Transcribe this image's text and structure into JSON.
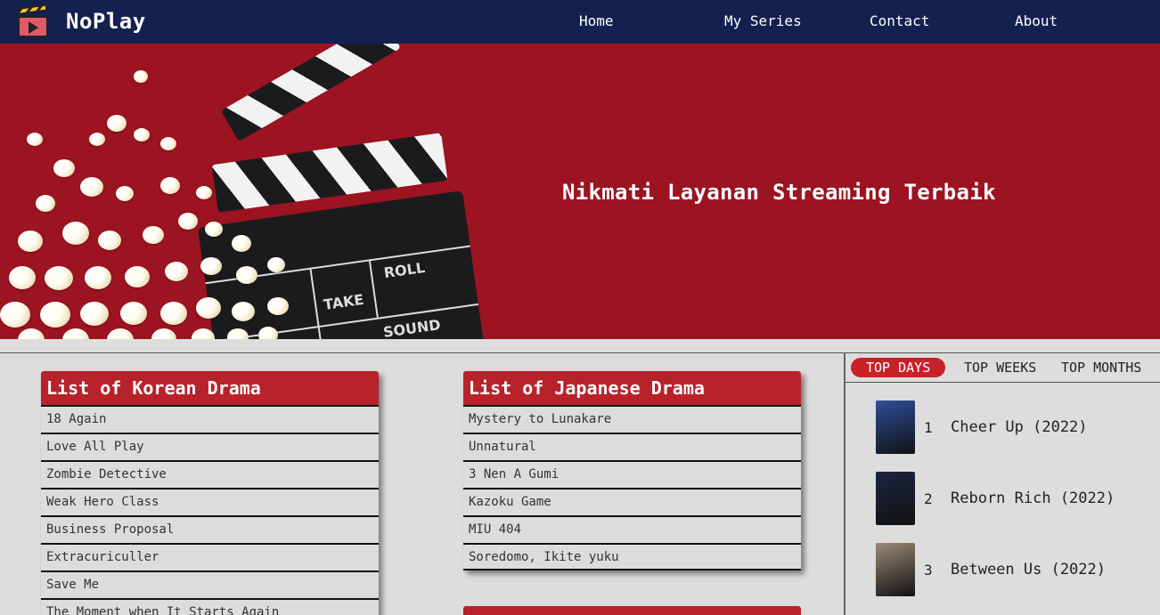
{
  "brand": {
    "name": "NoPlay"
  },
  "nav": [
    "Home",
    "My Series",
    "Contact",
    "About"
  ],
  "hero": {
    "title": "Nikmati Layanan Streaming Terbaik",
    "clapper_labels": [
      "TAKE",
      "ROLL",
      "SOUND"
    ]
  },
  "korean": {
    "title": "List of Korean Drama",
    "items": [
      "18 Again",
      "Love All Play",
      "Zombie Detective",
      "Weak Hero Class",
      "Business Proposal",
      "Extracuriculler",
      "Save Me",
      "The Moment when It Starts Again"
    ]
  },
  "japanese": {
    "title": "List of Japanese Drama",
    "items": [
      "Mystery to Lunakare",
      "Unnatural",
      "3 Nen A Gumi",
      "Kazoku Game",
      "MIU 404",
      "Soredomo, Ikite yuku"
    ]
  },
  "sidebar": {
    "tabs": [
      "TOP DAYS",
      "TOP WEEKS",
      "TOP MONTHS"
    ],
    "active_tab": "TOP DAYS",
    "ranking": [
      {
        "rank": "1",
        "title": "Cheer Up (2022)",
        "poster_color": "#2f4f9a"
      },
      {
        "rank": "2",
        "title": "Reborn Rich (2022)",
        "poster_color": "#1c2540"
      },
      {
        "rank": "3",
        "title": "Between Us (2022)",
        "poster_color": "#9a8a78"
      }
    ]
  },
  "colors": {
    "navbar": "#14204f",
    "hero": "#9c1322",
    "accent": "#b8222a",
    "background": "#dddddd"
  }
}
